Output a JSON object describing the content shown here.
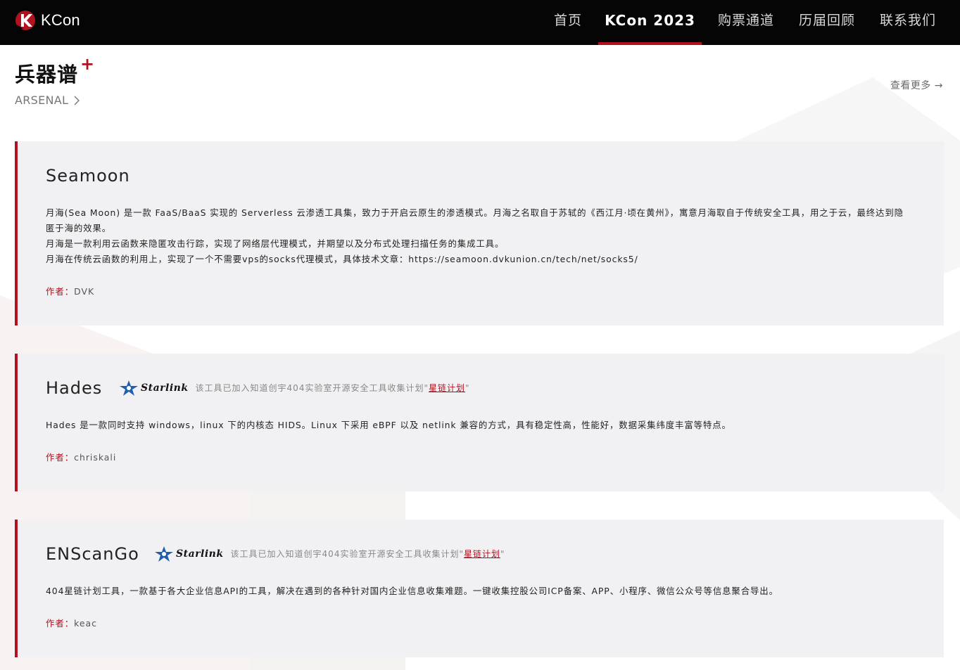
{
  "header": {
    "logo_text": "KCon",
    "nav": [
      {
        "label": "首页",
        "active": false
      },
      {
        "label": "KCon 2023",
        "active": true
      },
      {
        "label": "购票通道",
        "active": false
      },
      {
        "label": "历届回顾",
        "active": false
      },
      {
        "label": "联系我们",
        "active": false
      }
    ]
  },
  "section": {
    "title": "兵器谱",
    "plus": "+",
    "subtitle": "ARSENAL",
    "more": "查看更多 →"
  },
  "colors": {
    "accent": "#b1121f",
    "header_bg": "#050505",
    "card_bg": "#f0f0f2"
  },
  "cards": [
    {
      "name": "Seamoon",
      "starlink": null,
      "desc": [
        "月海(Sea Moon) 是一款 FaaS/BaaS 实现的 Serverless 云渗透工具集，致力于开启云原生的渗透模式。月海之名取自于苏轼的《西江月·顷在黄州》，寓意月海取自于传统安全工具，用之于云，最终达到隐匿于海的效果。",
        "月海是一款利用云函数来隐匿攻击行踪，实现了网络层代理模式，并期望以及分布式处理扫描任务的集成工具。",
        "月海在传统云函数的利用上，实现了一个不需要vps的socks代理模式，具体技术文章：https://seamoon.dvkunion.cn/tech/net/socks5/"
      ],
      "author_label": "作者：",
      "author": "DVK"
    },
    {
      "name": "Hades",
      "starlink": {
        "icon": "starlink-star-icon",
        "word": "Starlink",
        "text": "该工具已加入知道创宇404实验室开源安全工具收集计划\"",
        "link": "星链计划",
        "tail": "\""
      },
      "desc": [
        "Hades 是一款同时支持 windows，linux 下的内核态 HIDS。Linux 下采用 eBPF 以及 netlink 兼容的方式，具有稳定性高，性能好，数据采集纬度丰富等特点。"
      ],
      "author_label": "作者：",
      "author": "chriskali"
    },
    {
      "name": "ENScanGo",
      "starlink": {
        "icon": "starlink-star-icon",
        "word": "Starlink",
        "text": "该工具已加入知道创宇404实验室开源安全工具收集计划\"",
        "link": "星链计划",
        "tail": "\""
      },
      "desc": [
        "404星链计划工具，一款基于各大企业信息API的工具，解决在遇到的各种针对国内企业信息收集难题。一键收集控股公司ICP备案、APP、小程序、微信公众号等信息聚合导出。"
      ],
      "author_label": "作者：",
      "author": "keac"
    }
  ]
}
